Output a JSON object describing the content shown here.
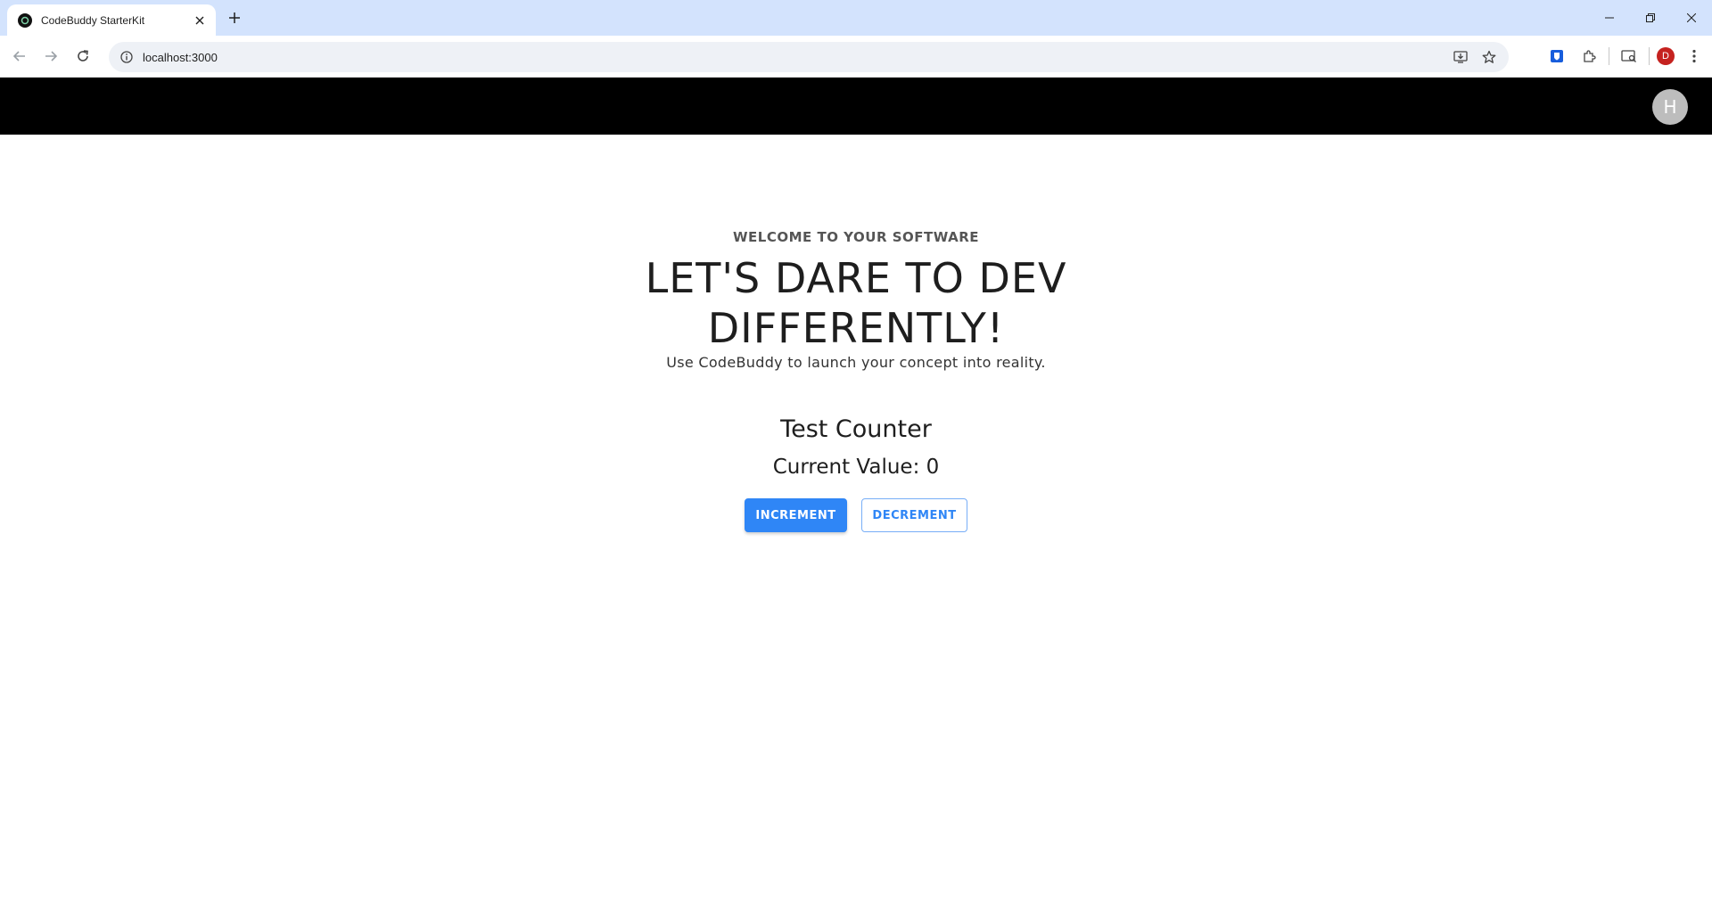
{
  "browser": {
    "tab_title": "CodeBuddy StarterKit",
    "url": "localhost:3000",
    "profile_initial": "D"
  },
  "header": {
    "avatar_initial": "H"
  },
  "hero": {
    "overline": "WELCOME TO YOUR SOFTWARE",
    "headline_line1": "LET'S DARE TO DEV",
    "headline_line2": "DIFFERENTLY!",
    "subtitle": "Use CodeBuddy to launch your concept into reality."
  },
  "counter": {
    "title": "Test Counter",
    "value_label": "Current Value: 0",
    "increment_label": "INCREMENT",
    "decrement_label": "DECREMENT"
  },
  "colors": {
    "accent": "#2f86f6",
    "header_bg": "#000000",
    "tabstrip_bg": "#d3e3fd"
  }
}
